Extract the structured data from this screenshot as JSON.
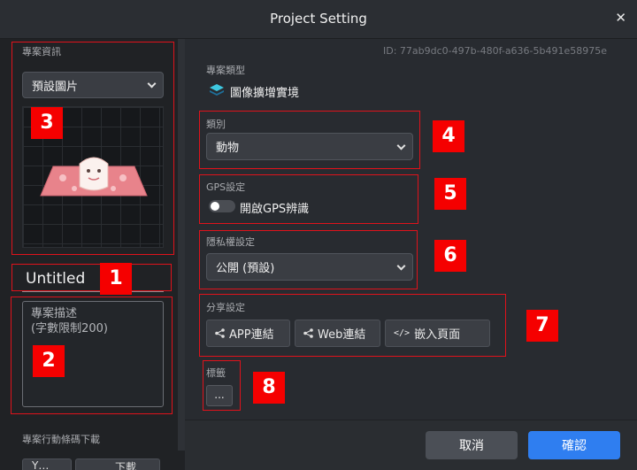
{
  "window": {
    "title": "Project Setting"
  },
  "left": {
    "info_label": "專案資訊",
    "preview_select": "預設圖片",
    "project_name": "Untitled",
    "description_placeholder": "專案描述\n(字數限制200)",
    "qr_label": "專案行動條碼下載",
    "partial_btn_1": "Y…",
    "partial_btn_2": "下載"
  },
  "right": {
    "id_text": "ID: 77ab9dc0-497b-480f-a636-5b491e58975e",
    "type_label": "專案類型",
    "type_value": "圖像擴增實境",
    "category_label": "類別",
    "category_value": "動物",
    "gps_label": "GPS設定",
    "gps_toggle_label": "開啟GPS辨識",
    "gps_enabled": false,
    "privacy_label": "隱私權設定",
    "privacy_value": "公開 (預設)",
    "share_label": "分享設定",
    "share_buttons": [
      "APP連結",
      "Web連結",
      "嵌入頁面"
    ],
    "tags_label": "標籤",
    "tags_button": "..."
  },
  "footer": {
    "cancel": "取消",
    "confirm": "確認"
  },
  "badges": [
    "1",
    "2",
    "3",
    "4",
    "5",
    "6",
    "7",
    "8"
  ],
  "colors": {
    "accent": "#2f7ef0",
    "annotation": "#f50000"
  },
  "icons": {
    "close": "close-icon",
    "chevron": "chevron-down-icon",
    "share": "share-icon",
    "embed": "code-icon",
    "ar": "ar-layers-icon"
  }
}
